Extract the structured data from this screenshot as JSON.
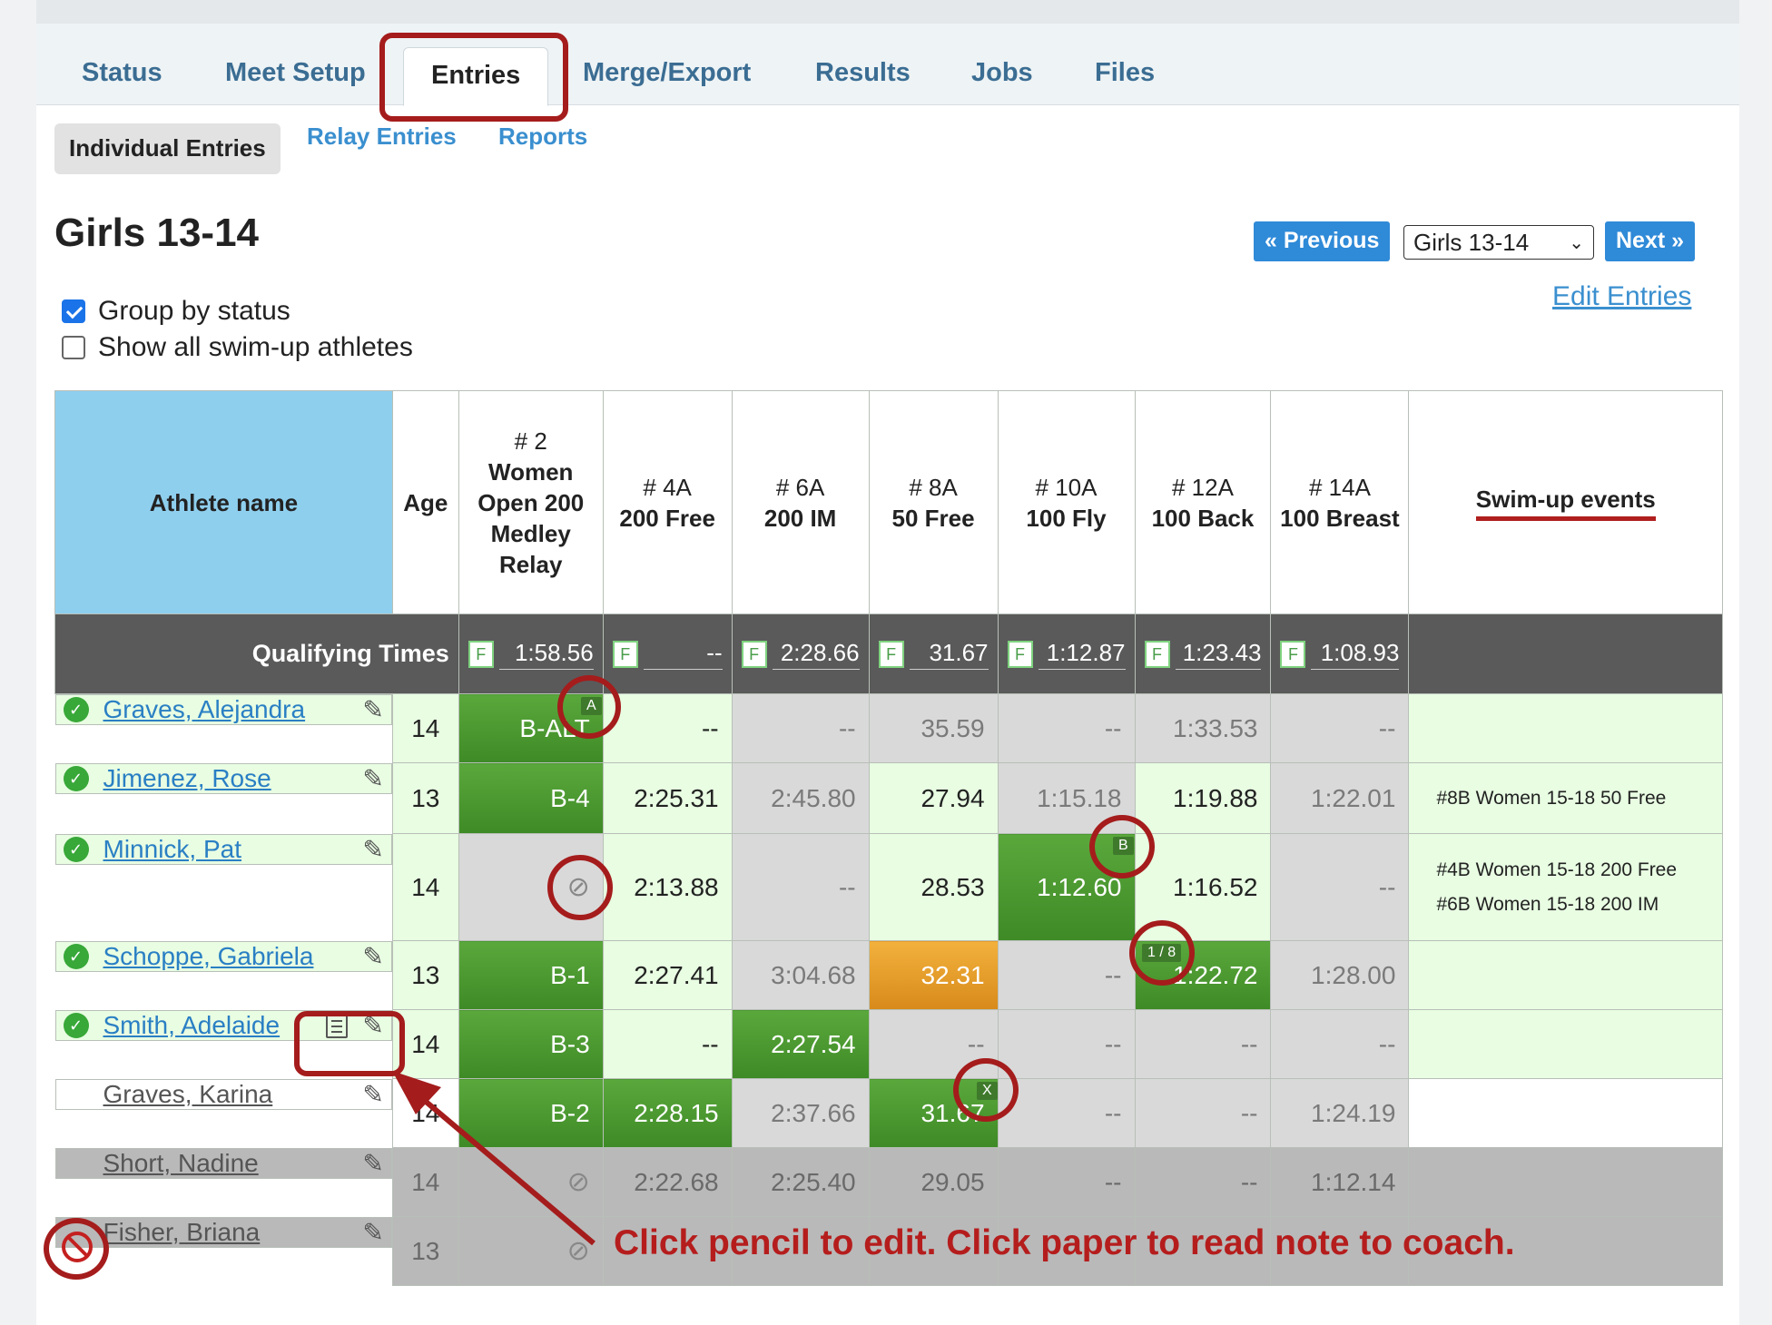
{
  "tabs": [
    "Status",
    "Meet Setup",
    "Entries",
    "Merge/Export",
    "Results",
    "Jobs",
    "Files"
  ],
  "subtabs": [
    "Individual Entries",
    "Relay Entries",
    "Reports"
  ],
  "group_title": "Girls 13-14",
  "nav": {
    "previous": "« Previous",
    "select_value": "Girls 13-14",
    "next": "Next »",
    "edit_entries": "Edit Entries"
  },
  "options": {
    "group_by_status": "Group by status",
    "show_all": "Show all swim-up athletes"
  },
  "header": {
    "athlete": "Athlete name",
    "age": "Age",
    "events": [
      {
        "num": "# 2",
        "name": "Women Open 200 Medley Relay"
      },
      {
        "num": "# 4A",
        "name": "200 Free"
      },
      {
        "num": "# 6A",
        "name": "200 IM"
      },
      {
        "num": "# 8A",
        "name": "50 Free"
      },
      {
        "num": "# 10A",
        "name": "100 Fly"
      },
      {
        "num": "# 12A",
        "name": "100 Back"
      },
      {
        "num": "# 14A",
        "name": "100 Breast"
      }
    ],
    "swimup": "Swim-up events"
  },
  "qualifying": {
    "label": "Qualifying Times",
    "flag": "F",
    "values": [
      "1:58.56",
      "--",
      "2:28.66",
      "31.67",
      "1:12.87",
      "1:23.43",
      "1:08.93"
    ]
  },
  "rows": [
    {
      "name": "Graves, Alejandra",
      "age": "14",
      "cells": [
        "B-ALT",
        "--",
        "--",
        "35.59",
        "--",
        "1:33.53",
        "--"
      ],
      "swimup": []
    },
    {
      "name": "Jimenez, Rose",
      "age": "13",
      "cells": [
        "B-4",
        "2:25.31",
        "2:45.80",
        "27.94",
        "1:15.18",
        "1:19.88",
        "1:22.01"
      ],
      "swimup": [
        "#8B Women 15-18 50 Free"
      ]
    },
    {
      "name": "Minnick, Pat",
      "age": "14",
      "cells": [
        "",
        "2:13.88",
        "--",
        "28.53",
        "1:12.60",
        "1:16.52",
        "--"
      ],
      "swimup": [
        "#4B Women 15-18 200 Free",
        "#6B Women 15-18 200 IM"
      ]
    },
    {
      "name": "Schoppe, Gabriela",
      "age": "13",
      "cells": [
        "B-1",
        "2:27.41",
        "3:04.68",
        "32.31",
        "--",
        "1:22.72",
        "1:28.00"
      ],
      "swimup": []
    },
    {
      "name": "Smith, Adelaide",
      "age": "14",
      "cells": [
        "B-3",
        "--",
        "2:27.54",
        "--",
        "--",
        "--",
        "--"
      ],
      "swimup": []
    },
    {
      "name": "Graves, Karina",
      "age": "14",
      "cells": [
        "B-2",
        "2:28.15",
        "2:37.66",
        "31.67",
        "--",
        "--",
        "1:24.19"
      ],
      "swimup": []
    },
    {
      "name": "Short, Nadine",
      "age": "14",
      "cells": [
        "",
        "2:22.68",
        "2:25.40",
        "29.05",
        "--",
        "--",
        "1:12.14"
      ],
      "swimup": []
    },
    {
      "name": "Fisher, Briana",
      "age": "13",
      "cells": [
        "",
        "",
        "",
        "",
        "",
        "",
        ""
      ],
      "swimup": []
    }
  ],
  "badges": {
    "a": "A",
    "b": "B",
    "one_eighth": "1 / 8",
    "x": "X"
  },
  "caption": "Click pencil to edit.  Click paper to read note to coach.",
  "colors": {
    "accent": "#2f8ad8",
    "annotation": "#a51c1c",
    "qualified": "#4a962f",
    "relay_bonus": "#e8a02a"
  }
}
